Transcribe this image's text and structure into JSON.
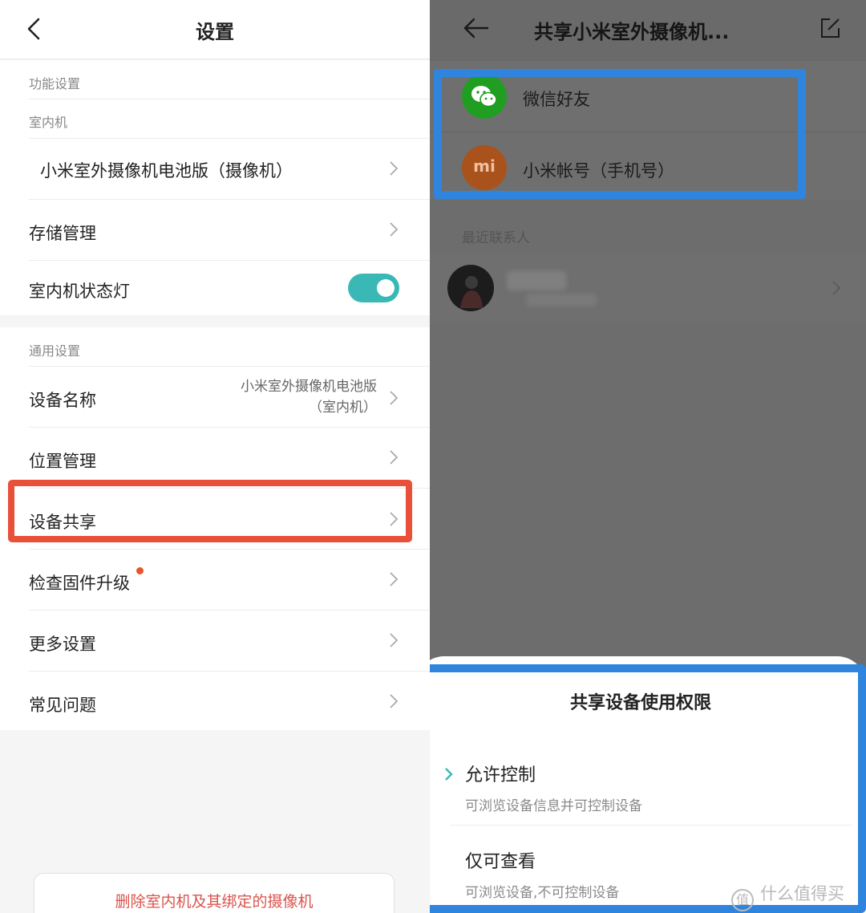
{
  "left": {
    "title": "设置",
    "sections": {
      "function": "功能设置",
      "indoor": "室内机",
      "general": "通用设置"
    },
    "rows": {
      "camera": "小米室外摄像机电池版（摄像机）",
      "storage": "存储管理",
      "status_light": "室内机状态灯",
      "device_name": "设备名称",
      "device_name_value_line1": "小米室外摄像机电池版",
      "device_name_value_line2": "（室内机）",
      "location": "位置管理",
      "share": "设备共享",
      "firmware": "检查固件升级",
      "more": "更多设置",
      "faq": "常见问题"
    },
    "status_light_on": true,
    "delete_button": "删除室内机及其绑定的摄像机",
    "colors": {
      "accent": "#3ab8b6",
      "highlight_red": "#e8503a",
      "danger_text": "#d9544d"
    }
  },
  "right": {
    "title": "共享小米室外摄像机...",
    "share_options": [
      {
        "label": "微信好友",
        "icon": "wechat-icon"
      },
      {
        "label": "小米帐号（手机号）",
        "icon": "mi-icon"
      }
    ],
    "recent_label": "最近联系人",
    "sheet": {
      "title": "共享设备使用权限",
      "options": [
        {
          "title": "允许控制",
          "desc": "可浏览设备信息并可控制设备",
          "selected": true
        },
        {
          "title": "仅可查看",
          "desc": "可浏览设备,不可控制设备",
          "selected": false
        }
      ]
    },
    "watermark": "什么值得买",
    "watermark_icon": "值",
    "mi_logo": "mi",
    "colors": {
      "highlight_blue": "#2f85de",
      "wechat_green": "#1f9e21",
      "mi_orange": "#a9521b"
    }
  }
}
